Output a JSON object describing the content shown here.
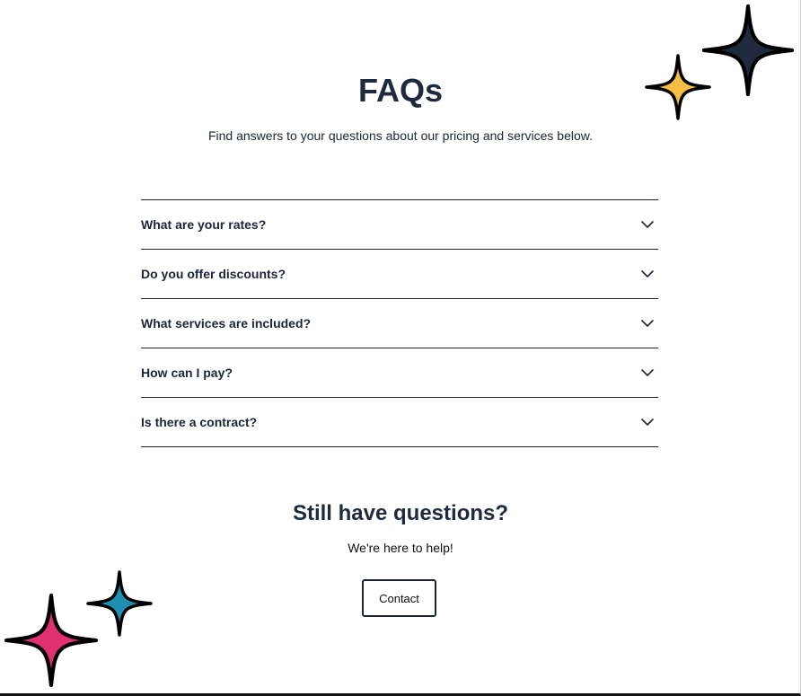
{
  "header": {
    "title": "FAQs",
    "subtitle": "Find answers to your questions about our pricing and services below."
  },
  "faqs": [
    {
      "question": "What are your rates?",
      "state": "collapsed"
    },
    {
      "question": "Do you offer discounts?",
      "state": "collapsed"
    },
    {
      "question": "What services are included?",
      "state": "collapsed"
    },
    {
      "question": "How can I pay?",
      "state": "collapsed"
    },
    {
      "question": "Is there a contract?",
      "state": "collapsed"
    }
  ],
  "cta": {
    "heading": "Still have questions?",
    "text": "We're here to help!",
    "button_label": "Contact"
  },
  "decorations": [
    {
      "icon": "sparkle-icon",
      "color": "#1f2a3f"
    },
    {
      "icon": "sparkle-icon",
      "color": "#f5bd41"
    },
    {
      "icon": "sparkle-icon",
      "color": "#1e8fb0"
    },
    {
      "icon": "sparkle-icon",
      "color": "#e0306f"
    }
  ],
  "colors": {
    "text": "#1c2439",
    "heading": "#1f2a3f",
    "background": "#ffffff"
  }
}
